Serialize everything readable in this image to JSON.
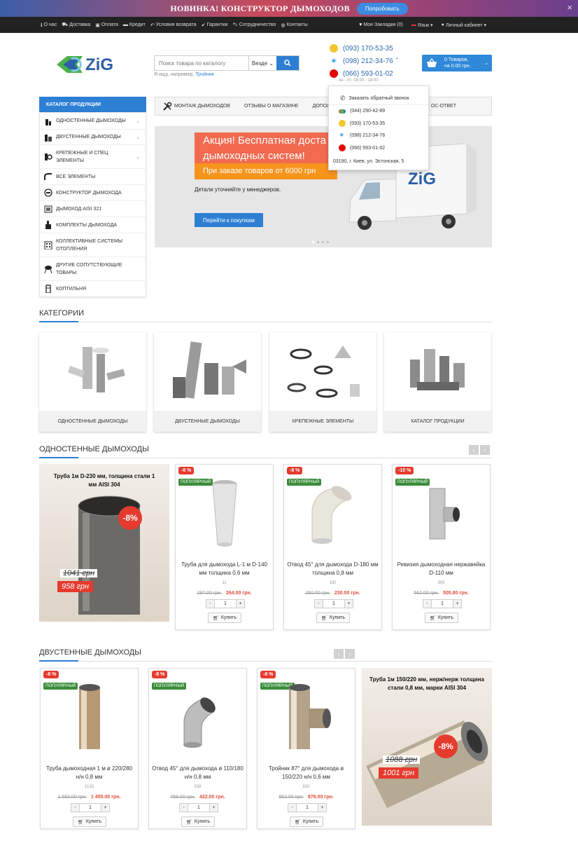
{
  "promo_bar": {
    "text": "НОВИНКА! КОНСТРУКТОР ДЫМОХОДОВ",
    "button": "Попробовать",
    "close": "×"
  },
  "topbar": {
    "left": [
      {
        "icon": "info-icon",
        "glyph": "ℹ",
        "label": "О нас"
      },
      {
        "icon": "truck-icon",
        "glyph": "⛟",
        "label": "Доставка"
      },
      {
        "icon": "money-icon",
        "glyph": "▣",
        "label": "Оплата"
      },
      {
        "icon": "card-icon",
        "glyph": "▬",
        "label": "Кредит"
      },
      {
        "icon": "return-icon",
        "glyph": "↶",
        "label": "Условия возврата"
      },
      {
        "icon": "check-icon",
        "glyph": "✔",
        "label": "Гарантии"
      },
      {
        "icon": "cart-icon",
        "glyph": "⛍",
        "label": "Сотрудничество"
      },
      {
        "icon": "globe-icon",
        "glyph": "◍",
        "label": "Контакты"
      }
    ],
    "right": [
      {
        "icon": "heart-icon",
        "glyph": "♥",
        "label": "Мои Закладки (0)"
      },
      {
        "icon": "flag-ru-icon",
        "glyph": "▬",
        "label": "Язык ▾"
      },
      {
        "icon": "user-icon",
        "glyph": "●",
        "label": "Личный кабинет ▾"
      }
    ]
  },
  "header": {
    "logo_text": "ZiG",
    "search": {
      "placeholder": "Поиск товара по каталогу",
      "scope": "Везде",
      "hint_prefix": "Я ищу, например,",
      "hint_link": "Тройник"
    },
    "phones": [
      "(093) 170-53-35",
      "(098) 212-34-76",
      "(066) 593-01-02"
    ],
    "hours": "пн - пт: 08:00 - 18:00",
    "cart": {
      "line1": "0 Товаров,",
      "line2": "на 0.00 грн."
    }
  },
  "contacts_dropdown": {
    "callback": "Заказать обратный звонок",
    "phones": [
      "(044) 290-42-89",
      "(093) 170-53-35",
      "(098) 212-34-76",
      "(066) 593-01-02"
    ],
    "address": "03190, г. Киев, ул. Эстонская, 5"
  },
  "catalog": {
    "title": "КАТАЛОГ ПРОДУКЦИИ",
    "items": [
      {
        "label": "ОДНОСТЕННЫЕ ДЫМОХОДЫ",
        "chevron": "⌄"
      },
      {
        "label": "ДВУСТЕННЫЕ ДЫМОХОДЫ",
        "chevron": "⌄"
      },
      {
        "label": "КРЕПЕЖНЫЕ И СПЕЦ ЭЛЕМЕНТЫ",
        "chevron": "⌄"
      },
      {
        "label": "ВСЕ ЭЛЕМЕНТЫ"
      },
      {
        "label": "КОНСТРУКТОР ДЫМОХОДА"
      },
      {
        "label": "ДЫМОХОД AISI 321"
      },
      {
        "label": "КОМПЛЕКТЫ ДЫМОХОДА"
      },
      {
        "label": "КОЛЛЕКТИВНЫЕ СИСТЕМЫ ОТОПЛЕНИЯ"
      },
      {
        "label": "ДРУГИЕ СОПУТСТВУЮЩИЕ ТОВАРЫ"
      },
      {
        "label": "КОПТИЛЬНЯ"
      }
    ]
  },
  "nav": {
    "items": [
      "МОНТАЖ ДЫМОХОДОВ",
      "ОТЗЫВЫ О МАГАЗИНЕ",
      "ДОПОЛНИТ",
      "ОС-ОТВЕТ"
    ]
  },
  "banner": {
    "line1": "Акция! Бесплатная доста",
    "line2": "дымоходных систем!",
    "line3": "При заказе товаров от 6000 грн",
    "detail": "Детали уточняйте у менеджеров.",
    "button": "Перейти к покупкам",
    "truck_logo": "ZiG"
  },
  "categories": {
    "title": "КАТЕГОРИИ",
    "items": [
      "ОДНОСТЕННЫЕ ДЫМОХОДЫ",
      "ДВУСТЕННЫЕ ДЫМОХОДЫ",
      "КРЕПЕЖНЫЕ ЭЛЕМЕНТЫ",
      "КАТАЛОГ ПРОДУКЦИИ"
    ]
  },
  "single_wall": {
    "title": "ОДНОСТЕННЫЕ ДЫМОХОДЫ",
    "promo": {
      "title": "Труба 1м D-230 мм, толщина стали 1 мм AISI 304",
      "badge": "-8%",
      "old": "1041 грн",
      "new": "958 грн"
    },
    "products": [
      {
        "discount": "-8 %",
        "badge": "ПОПУЛЯРНЫЙ",
        "name": "Труба для дымохода L-1 м D-140 мм толщина 0,6 мм",
        "sku": "11",
        "old": "287.00 грн.",
        "new": "264.00 грн.",
        "qty": "1",
        "buy": "Купить"
      },
      {
        "discount": "-8 %",
        "badge": "ПОПУЛЯРНЫЙ",
        "name": "Отвод 45° для дымохода D-180 мм толщина 0,8 мм",
        "sku": "150",
        "old": "250.00 грн.",
        "new": "230.00 грн.",
        "qty": "1",
        "buy": "Купить"
      },
      {
        "discount": "-10 %",
        "badge": "ПОПУЛЯРНЫЙ",
        "name": "Ревизия дымоходная нержавейка D-110 мм",
        "sku": "305",
        "old": "562.00 грн.",
        "new": "505.80 грн.",
        "qty": "1",
        "buy": "Купить"
      }
    ]
  },
  "double_wall": {
    "title": "ДВУСТЕННЫЕ ДЫМОХОДЫ",
    "promo": {
      "title": "Труба 1м 150/220 мм, нерж/нерж толщина стали 0,8 мм, марки AISI 304",
      "badge": "-8%",
      "old": "1088 грн",
      "new": "1001 грн"
    },
    "products": [
      {
        "discount": "-8 %",
        "badge": "ПОПУЛЯРНЫЙ",
        "name": "Труба дымоходная 1 м ø 220/280 н/н 0,8 мм",
        "sku": "1133",
        "old": "1 582.00 грн.",
        "new": "1 455.00 грн.",
        "qty": "1",
        "buy": "Купить"
      },
      {
        "discount": "-8 %",
        "badge": "ПОПУЛЯРНЫЙ",
        "name": "Отвод 45° для дымохода ø 110/180 н/н 0,8 мм",
        "sku": "539",
        "old": "459.00 грн.",
        "new": "422.00 грн.",
        "qty": "1",
        "buy": "Купить"
      },
      {
        "discount": "-8 %",
        "badge": "ПОПУЛЯРНЫЙ",
        "name": "Тройник 87° для дымохода ø 150/220 н/н 0,6 мм",
        "sku": "820",
        "old": "952.00 грн.",
        "new": "876.00 грн.",
        "qty": "1",
        "buy": "Купить"
      }
    ]
  },
  "controls": {
    "prev": "‹",
    "next": "›",
    "minus": "-",
    "plus": "+"
  },
  "colors": {
    "accent": "#2d7fd4",
    "sale": "#e53b2e",
    "popular": "#3a8d3a",
    "dark": "#222222"
  }
}
